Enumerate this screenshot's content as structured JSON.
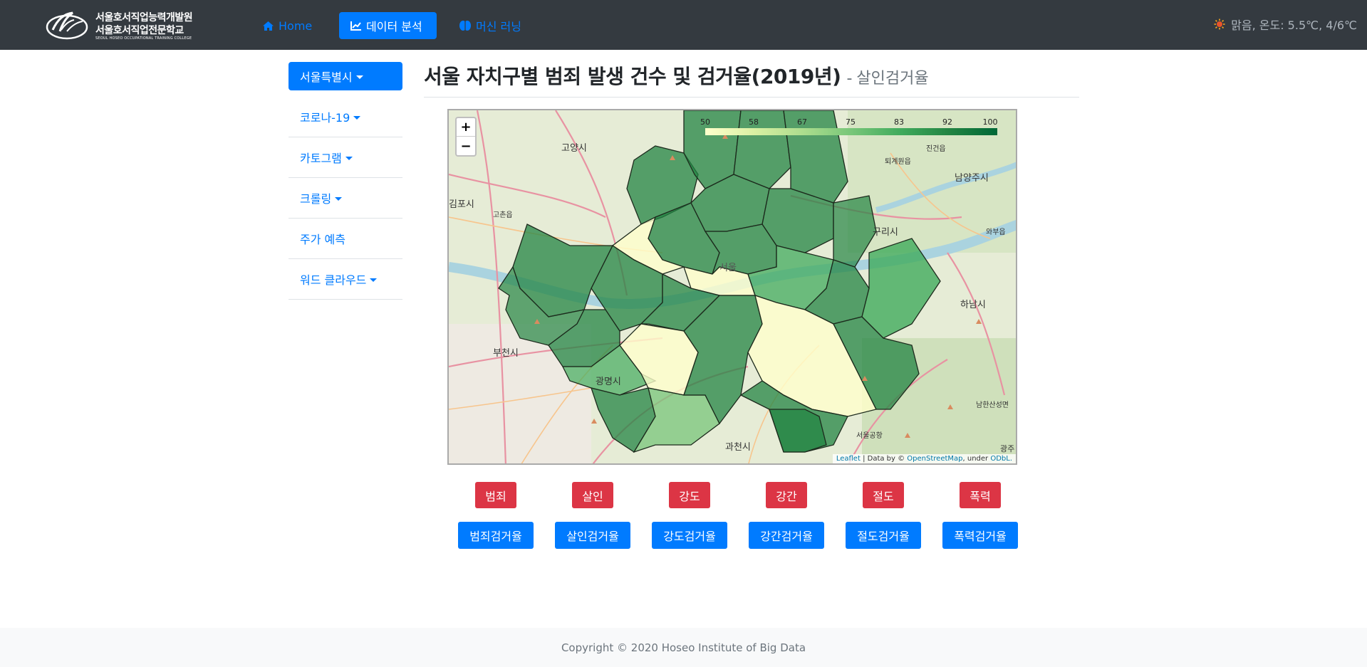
{
  "brand": {
    "line1": "서울호서직업능력개발원",
    "line2": "서울호서직업전문학교",
    "line3": "SEOUL HOSEO OCCUPATIONAL TRAINING COLLEGE"
  },
  "nav": {
    "home": "Home",
    "analysis": "데이터 분석",
    "ml": "머신 러닝"
  },
  "weather": "맑음, 온도: 5.5℃, 4/6℃",
  "sidebar": {
    "items": [
      {
        "label": "서울특별시",
        "dropdown": true,
        "active": true
      },
      {
        "label": "코로나-19",
        "dropdown": true
      },
      {
        "label": "카토그램",
        "dropdown": true
      },
      {
        "label": "크롤링",
        "dropdown": true
      },
      {
        "label": "주가 예측",
        "dropdown": false
      },
      {
        "label": "워드 클라우드",
        "dropdown": true
      }
    ]
  },
  "page": {
    "title": "서울 자치구별 범죄 발생 건수 및 검거율(2019년)",
    "separator": "-",
    "subtitle": "살인검거율"
  },
  "map": {
    "zoom_in": "+",
    "zoom_out": "−",
    "legend_ticks": [
      "50",
      "58",
      "67",
      "75",
      "83",
      "92",
      "100"
    ],
    "cities": [
      "고양시",
      "남양주시",
      "구리시",
      "하남시",
      "부천시",
      "광명시",
      "과천시",
      "김포시",
      "서울",
      "퇴계원읍",
      "진건읍",
      "와부읍",
      "고촌읍",
      "남한산성면",
      "서울공항",
      "광주"
    ],
    "attribution": {
      "leaflet": "Leaflet",
      "sep": " | Data by © ",
      "osm": "OpenStreetMap",
      "under": ", under ",
      "odbl": "ODbL."
    }
  },
  "buttons": {
    "crime": [
      "범죄",
      "살인",
      "강도",
      "강간",
      "절도",
      "폭력"
    ],
    "arrest": [
      "범죄검거율",
      "살인검거율",
      "강도검거율",
      "강간검거율",
      "절도검거율",
      "폭력검거율"
    ]
  },
  "footer": "Copyright © 2020 Hoseo Institute of Big Data",
  "colors": {
    "navbar": "#343a40",
    "primary": "#007bff",
    "danger": "#dc3545",
    "choropleth_dark": "#238443",
    "choropleth_light": "#ffffcc"
  }
}
